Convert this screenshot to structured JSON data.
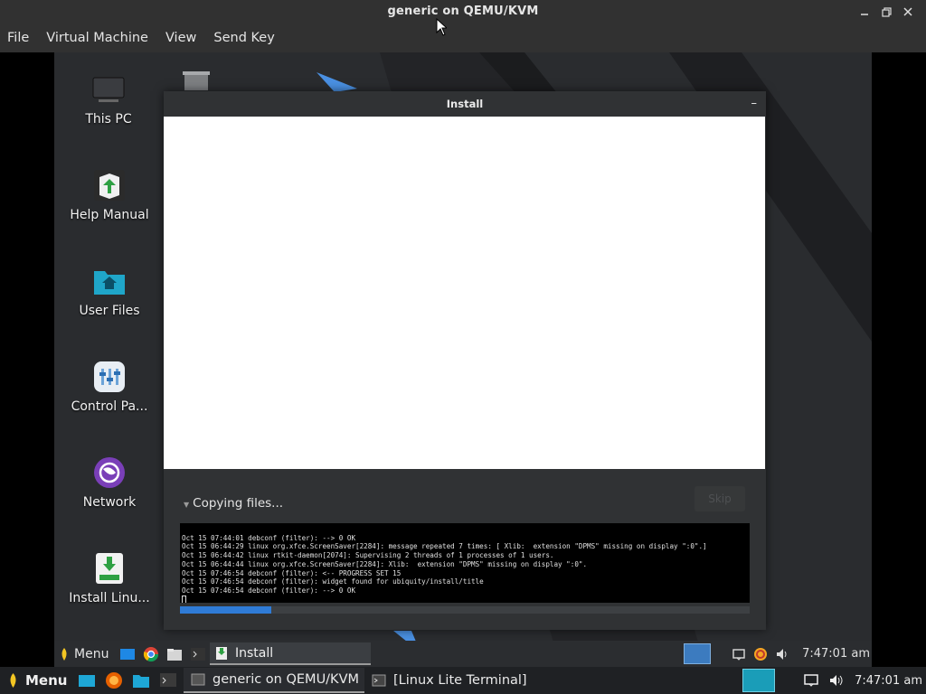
{
  "host_window": {
    "title": "generic on QEMU/KVM",
    "menu": [
      "File",
      "Virtual Machine",
      "View",
      "Send Key"
    ]
  },
  "desktop_icons": [
    {
      "label": "This PC",
      "icon": "computer-icon"
    },
    {
      "label": "Help Manual",
      "icon": "help-manual-icon"
    },
    {
      "label": "User Files",
      "icon": "home-folder-icon"
    },
    {
      "label": "Control Pa...",
      "icon": "control-panel-icon"
    },
    {
      "label": "Network",
      "icon": "network-icon"
    },
    {
      "label": "Install Linu...",
      "icon": "install-icon"
    }
  ],
  "install_dialog": {
    "title": "Install",
    "status": "Copying files...",
    "skip_label": "Skip",
    "progress": 0.16,
    "log_lines": [
      "Oct 15 07:44:01 debconf (filter): --> 0 OK",
      "Oct 15 06:44:29 linux org.xfce.ScreenSaver[2284]: message repeated 7 times: [ Xlib:  extension \"DPMS\" missing on display \":0\".]",
      "Oct 15 06:44:42 linux rtkit-daemon[2074]: Supervising 2 threads of 1 processes of 1 users.",
      "Oct 15 06:44:44 linux org.xfce.ScreenSaver[2284]: Xlib:  extension \"DPMS\" missing on display \":0\".",
      "Oct 15 07:46:54 debconf (filter): <-- PROGRESS SET 15",
      "Oct 15 07:46:54 debconf (filter): widget found for ubiquity/install/title",
      "Oct 15 07:46:54 debconf (filter): --> 0 OK"
    ]
  },
  "guest_taskbar": {
    "menu_label": "Menu",
    "active_task": "Install",
    "clock": "7:47:01 am"
  },
  "host_taskbar": {
    "menu_label": "Menu",
    "tasks": [
      "generic on QEMU/KVM",
      "[Linux Lite Terminal]"
    ],
    "clock": "7:47:01 am"
  },
  "colors": {
    "accent_blue": "#2f7bd6",
    "host_workspace": "#1a9db8"
  }
}
